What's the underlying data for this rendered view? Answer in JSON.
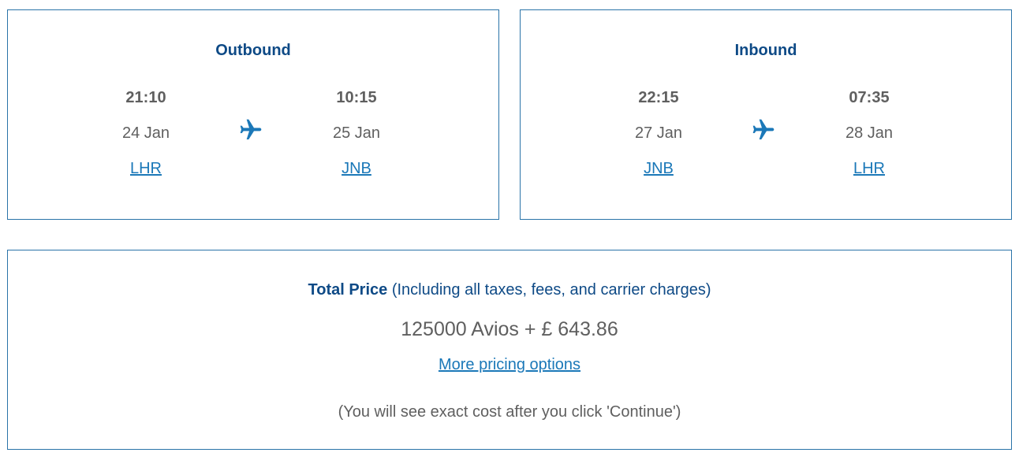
{
  "outbound": {
    "title": "Outbound",
    "departure": {
      "time": "21:10",
      "date": "24 Jan",
      "airport": "LHR"
    },
    "arrival": {
      "time": "10:15",
      "date": "25 Jan",
      "airport": "JNB"
    },
    "icon": "airplane-icon"
  },
  "inbound": {
    "title": "Inbound",
    "departure": {
      "time": "22:15",
      "date": "27 Jan",
      "airport": "JNB"
    },
    "arrival": {
      "time": "07:35",
      "date": "28 Jan",
      "airport": "LHR"
    },
    "icon": "airplane-icon"
  },
  "price": {
    "label": "Total Price",
    "label_note": " (Including all taxes, fees, and carrier charges)",
    "amount": "125000 Avios + £ 643.86",
    "more_link": "More pricing options",
    "note": "(You will see exact cost after you click 'Continue')"
  },
  "colors": {
    "border": "#2a73a8",
    "heading": "#0e4a86",
    "link": "#1b78b8",
    "text": "#5f5f5f",
    "icon": "#1b78b8"
  }
}
